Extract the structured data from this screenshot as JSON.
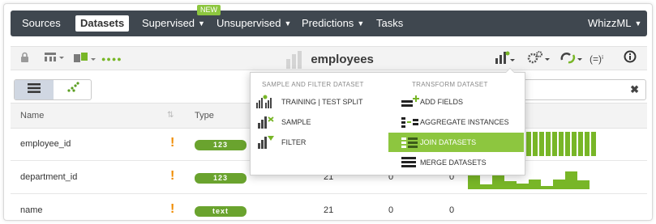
{
  "nav": {
    "items": [
      "Sources",
      "Datasets",
      "Supervised",
      "Unsupervised",
      "Predictions",
      "Tasks"
    ],
    "new_badge": "NEW",
    "right": "WhizzML"
  },
  "toolbar": {
    "title": "employees",
    "right_text": "(=)ⁱ"
  },
  "table": {
    "headers": [
      "Name",
      "Type"
    ],
    "rows": [
      {
        "name": "employee_id",
        "type": "123",
        "count": "",
        "missing": "",
        "errors": ""
      },
      {
        "name": "department_id",
        "type": "123",
        "count": "21",
        "missing": "0",
        "errors": "0"
      },
      {
        "name": "name",
        "type": "text",
        "count": "21",
        "missing": "0",
        "errors": "0"
      }
    ],
    "histograms": {
      "employee_id": [
        1,
        1,
        1,
        1,
        1,
        1,
        1,
        1,
        1,
        1,
        1,
        1,
        1,
        1,
        1,
        1,
        1,
        1,
        1,
        1
      ],
      "department_id": [
        0.85,
        0.25,
        0.85,
        0.45,
        0.3,
        0.55,
        0.2,
        0.55,
        1.0,
        0.5
      ]
    }
  },
  "dropdown": {
    "sections": [
      "SAMPLE AND FILTER DATASET",
      "TRANSFORM DATASET"
    ],
    "left_items": [
      "TRAINING | TEST SPLIT",
      "SAMPLE",
      "FILTER"
    ],
    "right_items": [
      "ADD FIELDS",
      "AGGREGATE INSTANCES",
      "JOIN DATASETS",
      "MERGE DATASETS"
    ],
    "highlighted": "JOIN DATASETS"
  },
  "colors": {
    "accent": "#8dc63f",
    "nav_bg": "#3f474f",
    "warning": "#f08c00"
  },
  "icons": [
    "lock-icon",
    "tree-icon",
    "dataset-icon",
    "dots-icon",
    "chart-icon",
    "gear-icon",
    "cloud-refresh-icon",
    "info-icon",
    "list-view-icon",
    "scatter-view-icon",
    "clear-icon",
    "warning-icon"
  ]
}
